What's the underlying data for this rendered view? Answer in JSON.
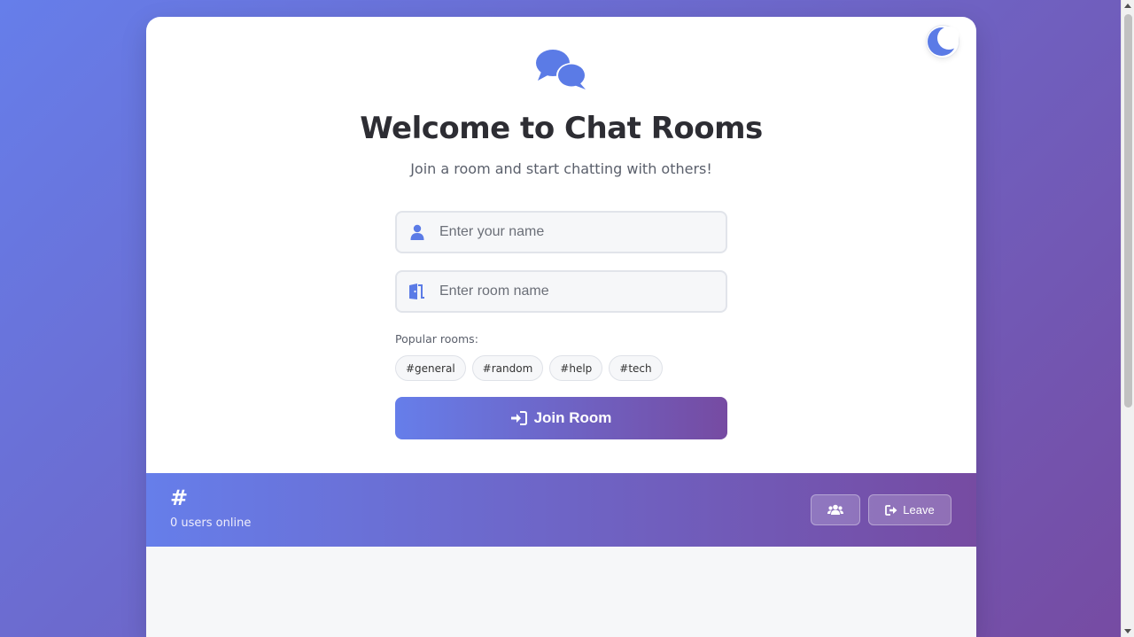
{
  "welcome": {
    "title": "Welcome to Chat Rooms",
    "subtitle": "Join a room and start chatting with others!",
    "logo_icon": "comments-icon"
  },
  "theme_toggle": {
    "icon": "moon-icon"
  },
  "form": {
    "name_placeholder": "Enter your name",
    "name_value": "",
    "name_icon": "user-icon",
    "room_placeholder": "Enter room name",
    "room_value": "",
    "room_icon": "door-icon",
    "popular_label": "Popular rooms:",
    "popular_rooms": [
      "#general",
      "#random",
      "#help",
      "#tech"
    ],
    "join_label": "Join Room",
    "join_icon": "sign-in-icon"
  },
  "room_header": {
    "room_name": "#",
    "users_online": "0 users online",
    "users_button_icon": "users-icon",
    "leave_label": "Leave",
    "leave_icon": "sign-out-icon"
  },
  "colors": {
    "gradient_start": "#667eea",
    "gradient_end": "#764ba2",
    "accent": "#5b7be6"
  }
}
